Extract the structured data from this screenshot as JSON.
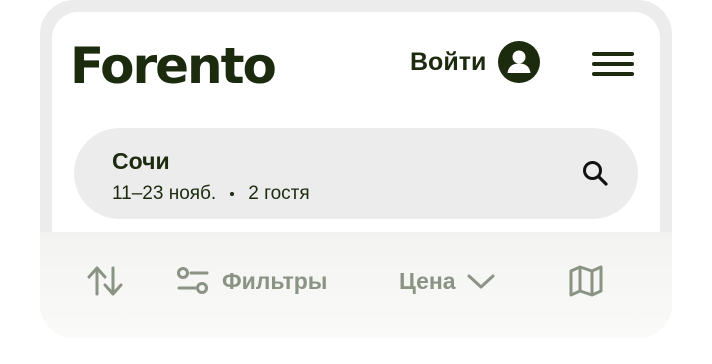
{
  "header": {
    "logo": "Forento",
    "login_label": "Войти"
  },
  "search": {
    "city": "Сочи",
    "dates": "11–23 нояб.",
    "guests": "2 гостя"
  },
  "toolbar": {
    "filters_label": "Фильтры",
    "price_label": "Цена"
  },
  "colors": {
    "brand_dark": "#1c2a0e",
    "muted": "#8a9384",
    "field_bg": "#ececec"
  },
  "icons": [
    "user-icon",
    "menu-icon",
    "search-icon",
    "sort-icon",
    "filter-icon",
    "chevron-down-icon",
    "map-icon"
  ]
}
